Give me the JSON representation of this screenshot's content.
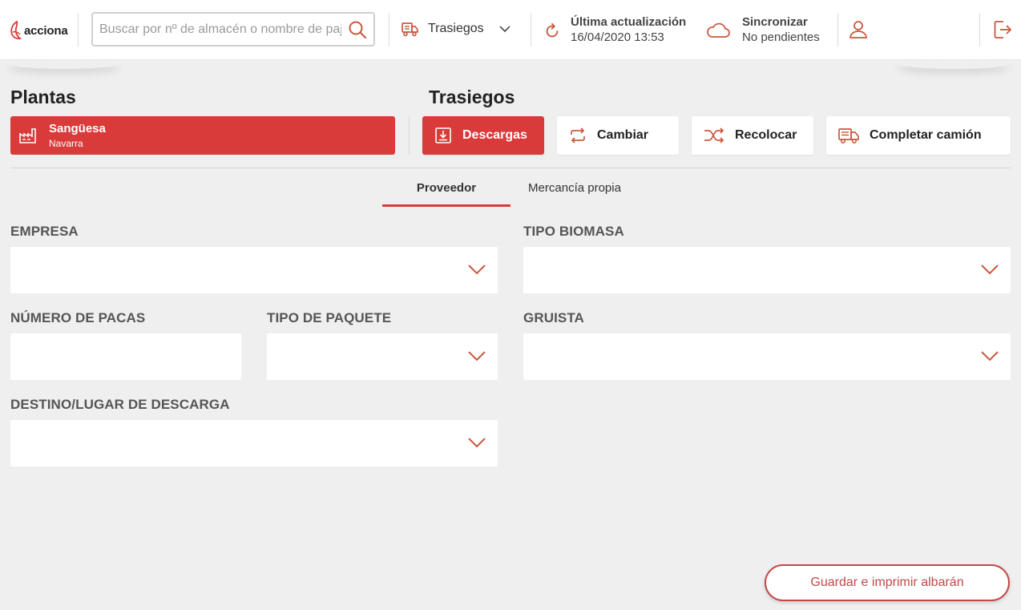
{
  "header": {
    "logo_text": "acciona",
    "search": {
      "placeholder": "Buscar por nº de almacén o nombre de pajero",
      "value": ""
    },
    "trasiegos_menu": {
      "label": "Trasiegos"
    },
    "last_update": {
      "label": "Última actualización",
      "value": "16/04/2020 13:53"
    },
    "sync": {
      "label": "Sincronizar",
      "status": "No pendientes"
    }
  },
  "plants": {
    "title": "Plantas",
    "selected": {
      "name": "Sangüesa",
      "region": "Navarra"
    }
  },
  "trasiegos": {
    "title": "Trasiegos",
    "actions": [
      {
        "label": "Descargas",
        "icon": "download-icon",
        "active": true
      },
      {
        "label": "Cambiar",
        "icon": "swap-icon",
        "active": false
      },
      {
        "label": "Recolocar",
        "icon": "shuffle-icon",
        "active": false
      },
      {
        "label": "Completar camión",
        "icon": "truck-icon",
        "active": false
      }
    ]
  },
  "tabs": [
    {
      "label": "Proveedor",
      "active": true
    },
    {
      "label": "Mercancía propia",
      "active": false
    }
  ],
  "form": {
    "empresa": {
      "label": "EMPRESA",
      "value": ""
    },
    "tipo_biomasa": {
      "label": "TIPO BIOMASA",
      "value": ""
    },
    "numero_pacas": {
      "label": "NÚMERO DE PACAS",
      "value": ""
    },
    "tipo_paquete": {
      "label": "TIPO DE PAQUETE",
      "value": ""
    },
    "gruista": {
      "label": "GRUISTA",
      "value": ""
    },
    "destino": {
      "label": "DESTINO/LUGAR DE DESCARGA",
      "value": ""
    }
  },
  "save_button": {
    "label": "Guardar e imprimir albarán"
  },
  "colors": {
    "accent": "#d93a3a",
    "icon": "#c8593f",
    "background": "#efefef"
  }
}
